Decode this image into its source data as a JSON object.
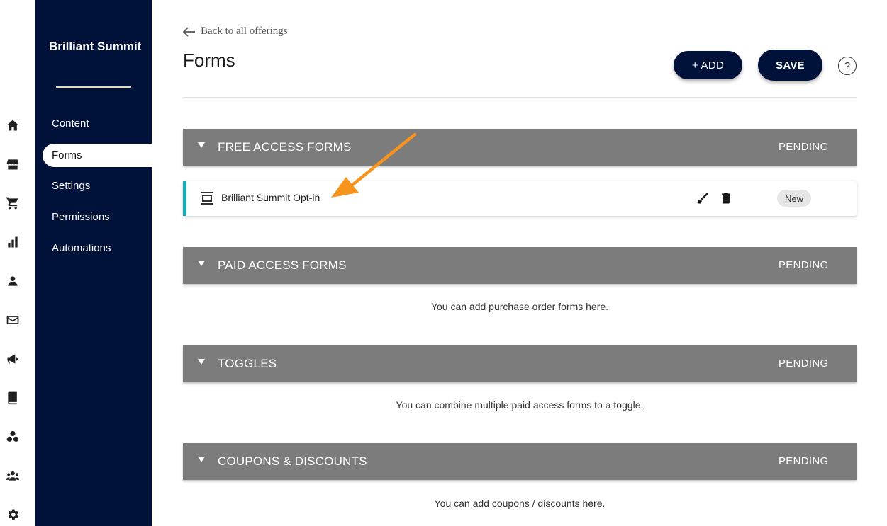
{
  "rail": {
    "icons": [
      "home-icon",
      "store-icon",
      "cart-icon",
      "bar-chart-icon",
      "person-icon",
      "mail-icon",
      "megaphone-icon",
      "book-icon",
      "circles-icon",
      "group-icon",
      "gear-icon"
    ]
  },
  "sidebar": {
    "brand": "Brilliant Summit",
    "items": [
      {
        "label": "Content"
      },
      {
        "label": "Forms",
        "active": true
      },
      {
        "label": "Settings"
      },
      {
        "label": "Permissions"
      },
      {
        "label": "Automations"
      }
    ]
  },
  "header": {
    "back_link": "Back to all offerings",
    "title": "Forms",
    "add_label": "+ ADD",
    "save_label": "SAVE",
    "help_label": "?"
  },
  "sections": [
    {
      "title": "FREE ACCESS FORMS",
      "status": "PENDING"
    },
    {
      "title": "PAID ACCESS FORMS",
      "status": "PENDING",
      "empty_text": "You can add purchase order forms here."
    },
    {
      "title": "TOGGLES",
      "status": "PENDING",
      "empty_text": "You can combine multiple paid access forms to a toggle."
    },
    {
      "title": "COUPONS & DISCOUNTS",
      "status": "PENDING",
      "empty_text": "You can add coupons / discounts here."
    }
  ],
  "free_forms": [
    {
      "name": "Brilliant Summit Opt-in",
      "badge": "New"
    }
  ],
  "colors": {
    "sidebar_bg": "#00113a",
    "section_bar": "#7c7c7c",
    "row_accent": "#17aab4",
    "annotation_arrow": "#f7941d"
  }
}
